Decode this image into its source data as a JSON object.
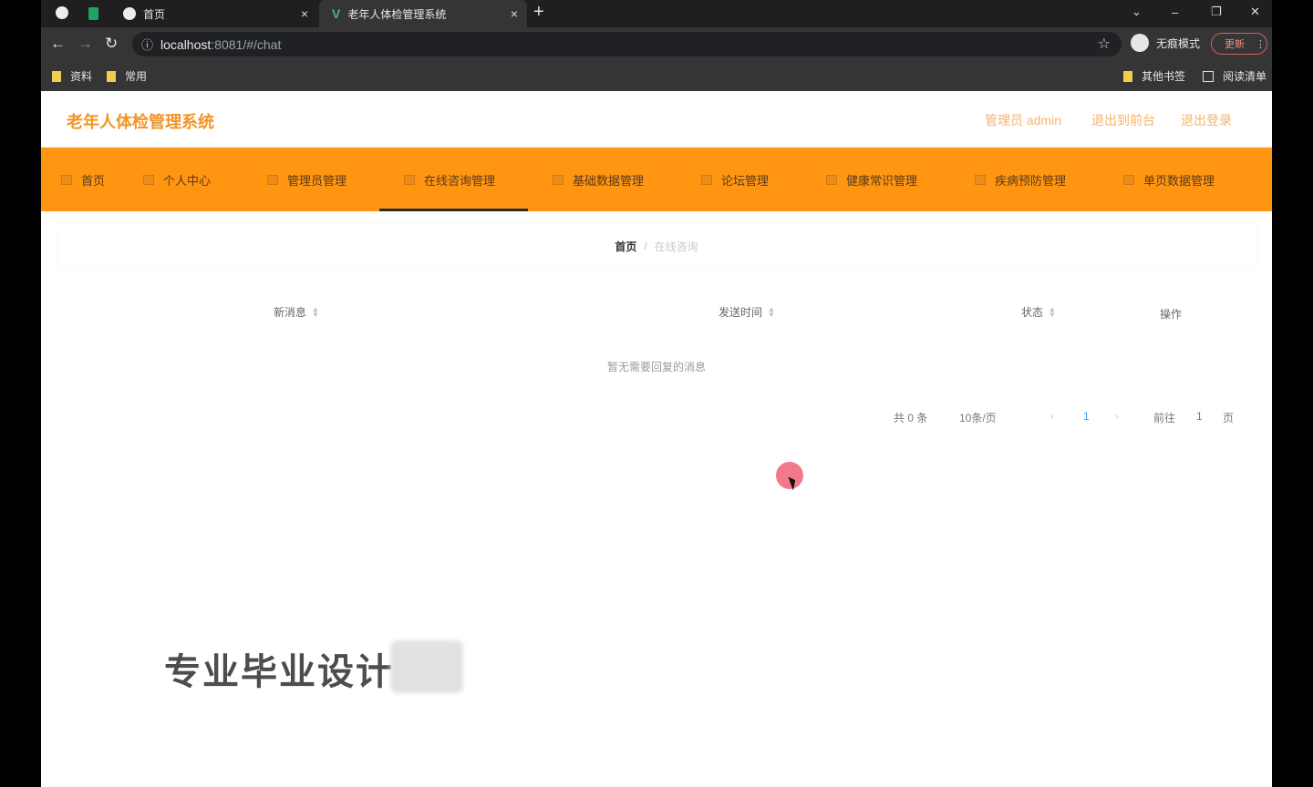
{
  "browser": {
    "tabs": [
      {
        "title": "首页",
        "close": "×"
      },
      {
        "title": "老年人体检管理系统",
        "close": "×"
      }
    ],
    "new_tab": "+",
    "window_controls": {
      "dropdown": "⌄",
      "minimize": "–",
      "restore": "❐",
      "close": "✕"
    },
    "nav": {
      "back": "←",
      "forward": "→",
      "reload": "↻"
    },
    "address": {
      "info_icon": "ⓘ",
      "host": "localhost",
      "rest": ":8081/#/chat",
      "star": "☆"
    },
    "incognito_label": "无痕模式",
    "update_label": "更新",
    "update_menu": "⋮",
    "bookmarks": [
      "资料",
      "常用"
    ],
    "bookmarks_right": {
      "other": "其他书签",
      "reading_list": "阅读清单"
    }
  },
  "app": {
    "title": "老年人体检管理系统",
    "user_label": "管理员 admin",
    "back_to_front": "退出到前台",
    "logout": "退出登录",
    "nav": [
      "首页",
      "个人中心",
      "管理员管理",
      "在线咨询管理",
      "基础数据管理",
      "论坛管理",
      "健康常识管理",
      "疾病预防管理",
      "单页数据管理"
    ],
    "active_nav_index": 3,
    "breadcrumb": {
      "home": "首页",
      "separator": "/",
      "current": "在线咨询"
    },
    "table": {
      "columns": [
        "新消息",
        "发送时间",
        "状态",
        "操作"
      ],
      "empty_text": "暂无需要回复的消息"
    },
    "pagination": {
      "total": "共 0 条",
      "page_size": "10条/页",
      "prev": "‹",
      "current": "1",
      "next": "›",
      "goto_label": "前往",
      "goto_value": "1",
      "page_suffix": "页"
    }
  },
  "overlay": {
    "watermark": "专业毕业设计代"
  },
  "colors": {
    "accent_orange": "#ff9511",
    "logo_orange": "#f39423",
    "link_orange": "#f5b36c"
  }
}
